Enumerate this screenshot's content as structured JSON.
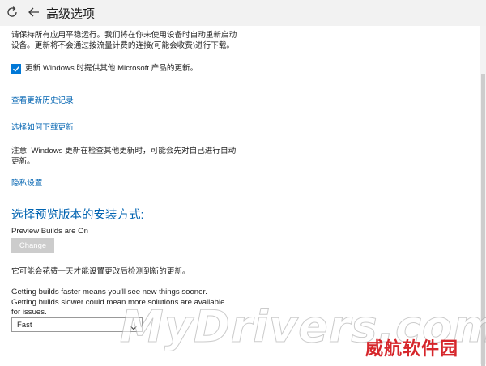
{
  "window": {
    "title": "高级选项"
  },
  "main": {
    "restart_text_line1": "请保持所有应用平稳运行。我们将在你未使用设备时自动重新启动",
    "restart_text_line2": "设备。更新将不会通过按流量计费的连接(可能会收费)进行下载。",
    "checkbox": {
      "label": "更新 Windows 时提供其他 Microsoft 产品的更新。",
      "checked": true
    },
    "link_history": "查看更新历史记录",
    "link_delivery": "选择如何下载更新",
    "note_line1": "注意: Windows 更新在检查其他更新时，可能会先对自己进行自动",
    "note_line2": "更新。",
    "link_privacy": "隐私设置",
    "preview_heading": "选择预览版本的安装方式:",
    "preview_status": "Preview Builds are On",
    "change_button": "Change",
    "preview_note": "它可能会花费一天才能设置更改后检测到新的更新。",
    "speed_text_line1": "Getting builds faster means you'll see new things sooner.",
    "speed_text_line2": "Getting builds slower could mean more solutions are available",
    "speed_text_line3": "for issues.",
    "speed_select": {
      "selected": "Fast"
    }
  },
  "watermark": {
    "text": "MyDrivers.com",
    "seal": "威航软件园"
  },
  "colors": {
    "accent": "#0078d7",
    "link": "#0063b1",
    "titlebar": "#f2f2f2",
    "seal": "#d6262b"
  },
  "icons": {
    "refresh": "refresh-icon",
    "back": "back-arrow-icon",
    "check": "checkmark-icon",
    "dropdown": "chevron-down-icon"
  }
}
